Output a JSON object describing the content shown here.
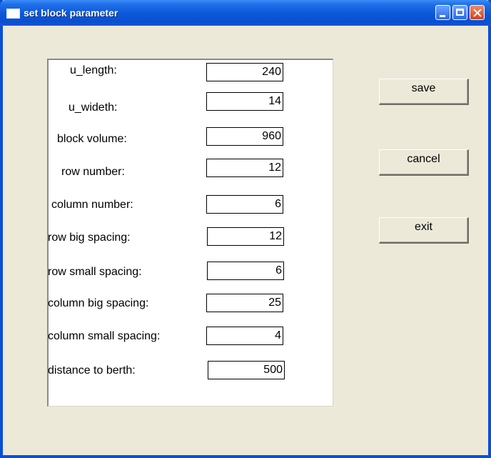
{
  "window": {
    "title": "set block parameter"
  },
  "fields": [
    {
      "label": "u_length:",
      "value": "240"
    },
    {
      "label": "u_wideth:",
      "value": "14"
    },
    {
      "label": "block volume:",
      "value": "960"
    },
    {
      "label": "row number:",
      "value": "12"
    },
    {
      "label": "column number:",
      "value": "6"
    },
    {
      "label": "row big spacing:",
      "value": "12"
    },
    {
      "label": "row small spacing:",
      "value": "6"
    },
    {
      "label": "column big spacing:",
      "value": "25"
    },
    {
      "label": "column small spacing:",
      "value": "4"
    },
    {
      "label": "distance to berth:",
      "value": "500"
    }
  ],
  "buttons": {
    "save": "save",
    "cancel": "cancel",
    "exit": "exit"
  }
}
